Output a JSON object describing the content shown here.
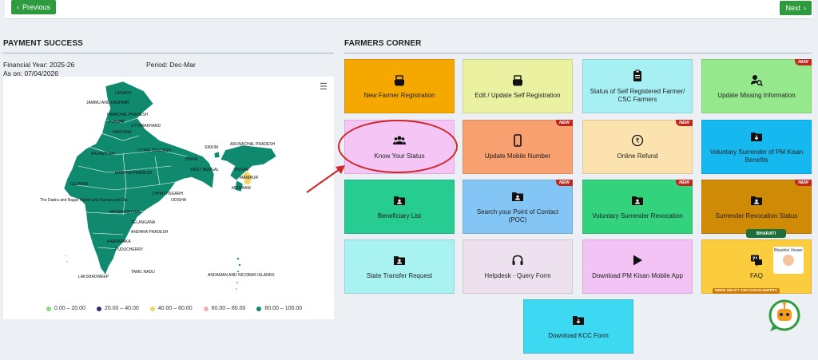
{
  "nav": {
    "previous_label": "Previous",
    "next_label": "Next"
  },
  "payment": {
    "title": "PAYMENT SUCCESS",
    "financial_year": "Financial Year: 2025-26",
    "period": "Period: Dec-Mar",
    "as_on": "As on: 07/04/2026",
    "map_labels": [
      "LADAKH",
      "JAMMU AND KASHMIR",
      "HIMACHAL PRADESH",
      "PUNJAB",
      "UTTARAKHAND",
      "HARYANA",
      "RAJASTHAN",
      "UTTAR PRADESH",
      "SIKKIM",
      "ARUNACHAL PRADESH",
      "BIHAR",
      "ASSAM",
      "MANIPUR",
      "MIZORAM",
      "WEST BENGAL",
      "MADHYA PRADESH",
      "GUJARAT",
      "CHHATTISGARH",
      "ODISHA",
      "The Dadra and Nagar Haveli and Daman and Diu",
      "MAHARASHTRA",
      "TELANGANA",
      "ANDHRA PRADESH",
      "KARNATAKA",
      "PUDUCHERRY",
      "TAMIL NADU",
      "LAKSHADWEEP",
      "ANDAMAN AND NICOBAR ISLANDS"
    ],
    "legend": [
      {
        "label": "0.00 – 20.00",
        "color": "#90d98a"
      },
      {
        "label": "20.00 – 40.00",
        "color": "#2a2f7a"
      },
      {
        "label": "40.00 – 60.00",
        "color": "#f1d36a"
      },
      {
        "label": "60.00 – 80.00",
        "color": "#f5b0b0"
      },
      {
        "label": "80.00 – 100.00",
        "color": "#0f8a6e"
      }
    ]
  },
  "farmers": {
    "title": "FARMERS CORNER",
    "new_badge": "NEW",
    "tiles": [
      {
        "label": "New Farmer Registration",
        "icon": "register-icon",
        "color": "#f5a800",
        "new": false
      },
      {
        "label": "Edit / Update Self Registration",
        "icon": "register-icon",
        "color": "#eaf2a2",
        "new": false
      },
      {
        "label": "Status of Self Registered Farmer/ CSC Farmers",
        "icon": "clipboard-icon",
        "color": "#a6f0f4",
        "new": false
      },
      {
        "label": "Update Missing Information",
        "icon": "user-search-icon",
        "color": "#95e98c",
        "new": true
      },
      {
        "label": "Know Your Status",
        "icon": "users-icon",
        "color": "#f5c6f5",
        "new": false
      },
      {
        "label": "Update Mobile Number",
        "icon": "mobile-icon",
        "color": "#f8a070",
        "new": true
      },
      {
        "label": "Online Refund",
        "icon": "rupee-refund-icon",
        "color": "#fbe2ae",
        "new": true
      },
      {
        "label": "Voluntary Surrender of PM Kisan Benefits",
        "icon": "folder-download-icon",
        "color": "#16b8f0",
        "new": false
      },
      {
        "label": "Beneficiary List",
        "icon": "folder-user-icon",
        "color": "#26cc92",
        "new": false
      },
      {
        "label": "Search your Point of Contact (POC)",
        "icon": "folder-user-icon",
        "color": "#83c5f5",
        "new": true
      },
      {
        "label": "Voluntary Surrender Revocation",
        "icon": "folder-user-icon",
        "color": "#33d27d",
        "new": true
      },
      {
        "label": "Surrender Revocation Status",
        "icon": "folder-user-icon",
        "color": "#cf8a06",
        "new": true
      },
      {
        "label": "State Transfer Request",
        "icon": "folder-user-icon",
        "color": "#a8f3f2",
        "new": false
      },
      {
        "label": "Helpdesk - Query Form",
        "icon": "headphones-icon",
        "color": "#ede1f0",
        "new": false
      },
      {
        "label": "Download PM Kisan Mobile App",
        "icon": "play-store-icon",
        "color": "#f2c3f4",
        "new": false
      },
      {
        "label": "FAQ",
        "icon": "faq-icon",
        "color": "#fbcd3e",
        "new": false
      },
      {
        "label": "Download KCC Form",
        "icon": "folder-download-icon",
        "color": "#3dd8f2",
        "new": false
      }
    ],
    "bharati_label": "BHARATI",
    "need_help_label": "NEED HELP? ASK KISAN-EMITRA",
    "bhashini_label": "Bhashini Viewer"
  }
}
